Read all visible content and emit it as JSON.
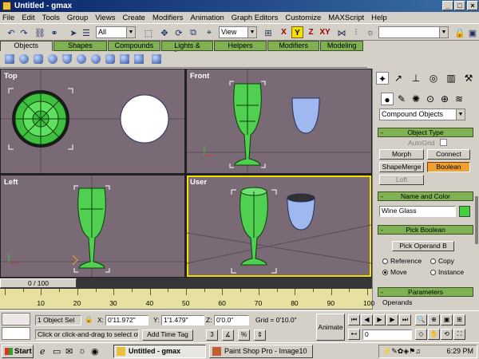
{
  "window": {
    "title": "Untitled - gmax"
  },
  "menu": [
    "File",
    "Edit",
    "Tools",
    "Group",
    "Views",
    "Create",
    "Modifiers",
    "Animation",
    "Graph Editors",
    "Customize",
    "MAXScript",
    "Help"
  ],
  "toolbar": {
    "selection_filter": "All",
    "ref_coord": "View",
    "axes": [
      "X",
      "Y",
      "Z",
      "XY"
    ],
    "named_selection": ""
  },
  "tabs": [
    "Objects",
    "Shapes",
    "Compounds",
    "Lights & Cameras",
    "Helpers",
    "Modifiers",
    "Modeling"
  ],
  "viewports": {
    "top": "Top",
    "front": "Front",
    "left": "Left",
    "user": "User"
  },
  "command_panel": {
    "category": "Compound Objects",
    "object_type": {
      "title": "Object Type",
      "autogrid": "AutoGrid",
      "buttons": [
        "Morph",
        "Connect",
        "ShapeMerge",
        "Boolean",
        "Loft"
      ]
    },
    "name_color": {
      "title": "Name and Color",
      "name": "Wine Glass",
      "color": "#40d040"
    },
    "pick_boolean": {
      "title": "Pick Boolean",
      "pick_button": "Pick Operand B",
      "options": [
        "Reference",
        "Copy",
        "Move",
        "Instance"
      ],
      "selected": "Move"
    },
    "parameters": {
      "title": "Parameters",
      "operands_label": "Operands"
    }
  },
  "timeline": {
    "slider": "0 / 100",
    "ticks": [
      "10",
      "20",
      "30",
      "40",
      "50",
      "60",
      "70",
      "80",
      "90",
      "100"
    ]
  },
  "status": {
    "selection": "1 Object Sel",
    "x_label": "X:",
    "x": "0'11.972\"",
    "y_label": "Y:",
    "y": "1'1.479\"",
    "z_label": "Z:",
    "z": "0'0.0\"",
    "grid": "Grid = 0'10.0\"",
    "prompt": "Click or click-and-drag to select obje",
    "add_time_tag": "Add Time Tag",
    "animate": "Animate",
    "frame": "0"
  },
  "taskbar": {
    "start": "Start",
    "tasks": [
      "Untitled - gmax",
      "Paint Shop Pro - Image10"
    ],
    "clock": "6:29 PM"
  },
  "colors": {
    "viewport_bg": "#7a6a76",
    "tab_green": "#7fb052",
    "active_viewport": "#f4e000",
    "boolean_active": "#f0a030"
  }
}
